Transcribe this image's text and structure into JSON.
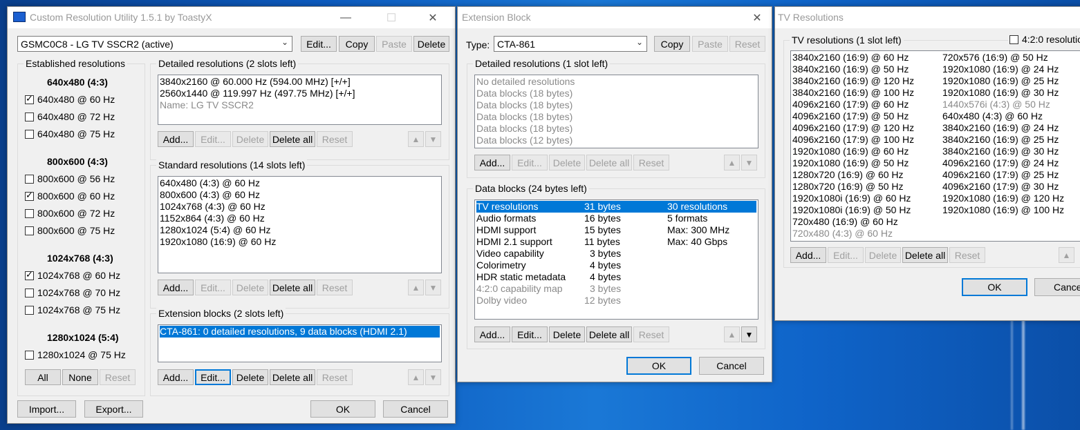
{
  "cru": {
    "title": "Custom Resolution Utility 1.5.1 by ToastyX",
    "monitor": "GSMC0C8 - LG TV SSCR2 (active)",
    "top_buttons": [
      "Edit...",
      "Copy",
      "Paste",
      "Delete"
    ],
    "established": {
      "label": "Established resolutions",
      "groups": [
        {
          "heading": "640x480 (4:3)",
          "items": [
            {
              "label": "640x480 @ 60 Hz",
              "checked": true
            },
            {
              "label": "640x480 @ 72 Hz",
              "checked": false
            },
            {
              "label": "640x480 @ 75 Hz",
              "checked": false
            }
          ]
        },
        {
          "heading": "800x600 (4:3)",
          "items": [
            {
              "label": "800x600 @ 56 Hz",
              "checked": false
            },
            {
              "label": "800x600 @ 60 Hz",
              "checked": true
            },
            {
              "label": "800x600 @ 72 Hz",
              "checked": false
            },
            {
              "label": "800x600 @ 75 Hz",
              "checked": false
            }
          ]
        },
        {
          "heading": "1024x768 (4:3)",
          "items": [
            {
              "label": "1024x768 @ 60 Hz",
              "checked": true
            },
            {
              "label": "1024x768 @ 70 Hz",
              "checked": false
            },
            {
              "label": "1024x768 @ 75 Hz",
              "checked": false
            }
          ]
        },
        {
          "heading": "1280x1024 (5:4)",
          "items": [
            {
              "label": "1280x1024 @ 75 Hz",
              "checked": false
            }
          ]
        }
      ],
      "buttons": [
        "All",
        "None",
        "Reset"
      ]
    },
    "detailed": {
      "label": "Detailed resolutions (2 slots left)",
      "rows": [
        "3840x2160 @ 60.000 Hz (594.00 MHz) [+/+]",
        "2560x1440 @ 119.997 Hz (497.75 MHz) [+/+]",
        "Name: LG TV SSCR2"
      ]
    },
    "standard": {
      "label": "Standard resolutions (14 slots left)",
      "rows": [
        "640x480 (4:3) @ 60 Hz",
        "800x600 (4:3) @ 60 Hz",
        "1024x768 (4:3) @ 60 Hz",
        "1152x864 (4:3) @ 60 Hz",
        "1280x1024 (5:4) @ 60 Hz",
        "1920x1080 (16:9) @ 60 Hz"
      ]
    },
    "extension": {
      "label": "Extension blocks (2 slots left)",
      "rows": [
        "CTA-861: 0 detailed resolutions, 9 data blocks (HDMI 2.1)"
      ]
    },
    "list_buttons": [
      "Add...",
      "Edit...",
      "Delete",
      "Delete all",
      "Reset"
    ],
    "arrows": [
      "▲",
      "▼"
    ],
    "bottom": {
      "import": "Import...",
      "export": "Export...",
      "ok": "OK",
      "cancel": "Cancel"
    }
  },
  "ext": {
    "title": "Extension Block",
    "type_label": "Type:",
    "type_value": "CTA-861",
    "top_buttons": [
      "Copy",
      "Paste",
      "Reset"
    ],
    "detailed": {
      "label": "Detailed resolutions (1 slot left)",
      "rows": [
        "No detailed resolutions",
        "Data blocks (18 bytes)",
        "Data blocks (18 bytes)",
        "Data blocks (18 bytes)",
        "Data blocks (18 bytes)",
        "Data blocks (12 bytes)"
      ]
    },
    "data_blocks": {
      "label": "Data blocks (24 bytes left)",
      "rows": [
        [
          "TV resolutions",
          "31 bytes",
          "30 resolutions"
        ],
        [
          "Audio formats",
          "16 bytes",
          "5 formats"
        ],
        [
          "HDMI support",
          "15 bytes",
          "Max: 300 MHz"
        ],
        [
          "HDMI 2.1 support",
          "11 bytes",
          "Max: 40 Gbps"
        ],
        [
          "Video capability",
          "3 bytes",
          ""
        ],
        [
          "Colorimetry",
          "4 bytes",
          ""
        ],
        [
          "HDR static metadata",
          "4 bytes",
          ""
        ],
        [
          "4:2:0 capability map",
          "3 bytes",
          ""
        ],
        [
          "Dolby video",
          "12 bytes",
          ""
        ]
      ]
    },
    "list_buttons": [
      "Add...",
      "Edit...",
      "Delete",
      "Delete all",
      "Reset"
    ],
    "arrows": [
      "▲",
      "▼"
    ],
    "ok": "OK",
    "cancel": "Cancel"
  },
  "tv": {
    "title": "TV Resolutions",
    "label": "TV resolutions (1 slot left)",
    "checkbox_420": "4:2:0 resolutio",
    "col1": [
      "3840x2160 (16:9) @ 60 Hz",
      "3840x2160 (16:9) @ 50 Hz",
      "3840x2160 (16:9) @ 120 Hz",
      "3840x2160 (16:9) @ 100 Hz",
      "4096x2160 (17:9) @ 60 Hz",
      "4096x2160 (17:9) @ 50 Hz",
      "4096x2160 (17:9) @ 120 Hz",
      "4096x2160 (17:9) @ 100 Hz",
      "1920x1080 (16:9) @ 60 Hz",
      "1920x1080 (16:9) @ 50 Hz",
      "1280x720 (16:9) @ 60 Hz",
      "1280x720 (16:9) @ 50 Hz",
      "1920x1080i (16:9) @ 60 Hz",
      "1920x1080i (16:9) @ 50 Hz",
      "720x480 (16:9) @ 60 Hz",
      "720x480 (4:3) @ 60 Hz"
    ],
    "col2": [
      "720x576 (16:9) @ 50 Hz",
      "1920x1080 (16:9) @ 24 Hz",
      "1920x1080 (16:9) @ 25 Hz",
      "1920x1080 (16:9) @ 30 Hz",
      "1440x576i (4:3) @ 50 Hz",
      "640x480 (4:3) @ 60 Hz",
      "3840x2160 (16:9) @ 24 Hz",
      "3840x2160 (16:9) @ 25 Hz",
      "3840x2160 (16:9) @ 30 Hz",
      "4096x2160 (17:9) @ 24 Hz",
      "4096x2160 (17:9) @ 25 Hz",
      "4096x2160 (17:9) @ 30 Hz",
      "1920x1080 (16:9) @ 120 Hz",
      "1920x1080 (16:9) @ 100 Hz"
    ],
    "list_buttons": [
      "Add...",
      "Edit...",
      "Delete",
      "Delete all",
      "Reset"
    ],
    "arrows": [
      "▲"
    ],
    "ok": "OK",
    "cancel": "Cance"
  }
}
